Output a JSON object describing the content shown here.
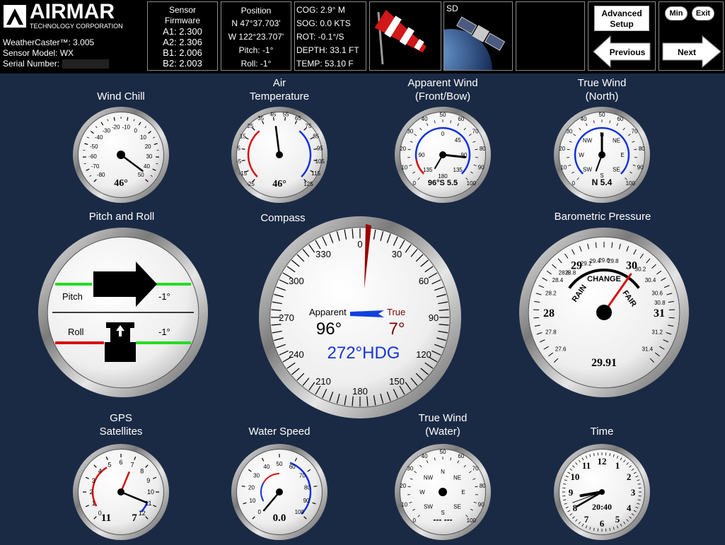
{
  "header": {
    "logo": {
      "name": "AIRMAR",
      "subtitle": "TECHNOLOGY CORPORATION"
    },
    "weathercaster_version": "WeatherCaster™: 3.005",
    "sensor_model": "Sensor Model: WX",
    "serial_label": "Serial Number:",
    "firmware": {
      "title1": "Sensor",
      "title2": "Firmware",
      "a1": "A1: 2.300",
      "a2": "A2: 2.306",
      "b1": "B1: 2.006",
      "b2": "B2: 2.003"
    },
    "position": {
      "title": "Position",
      "lat": "N 47°37.703'",
      "lon": "W 122°23.707'",
      "pitch": "Pitch: -1°",
      "roll": "Roll: -1°"
    },
    "nav_readout": {
      "cog": "COG: 2.9° M",
      "sog": "SOG: 0.0 KTS",
      "rot": "ROT: -0.1°/S",
      "depth": "DEPTH: 33.1 FT",
      "temp": "TEMP: 53.10 F"
    },
    "windsock_icon": "windsock-icon",
    "sd_label": "SD",
    "satellite_icon": "satellite-icon",
    "buttons": {
      "advanced_line1": "Advanced",
      "advanced_line2": "Setup",
      "min": "Min",
      "exit": "Exit",
      "previous": "Previous",
      "next": "Next"
    }
  },
  "gauges": {
    "wind_chill": {
      "label": "Wind Chill",
      "value": "46°",
      "ticks": [
        "-80",
        "-70",
        "-60",
        "-50",
        "-40",
        "-30",
        "-20",
        "-10",
        "0",
        "10",
        "20",
        "30",
        "40",
        "50"
      ],
      "needle_value": 46
    },
    "air_temp": {
      "label1": "Air",
      "label2": "Temperature",
      "value": "46°",
      "ticks": [
        "-25",
        "-15",
        "-5",
        "5",
        "15",
        "25",
        "35",
        "45",
        "55",
        "65",
        "75",
        "85",
        "95",
        "105",
        "115",
        "125"
      ],
      "needle_value": 46
    },
    "apparent_wind": {
      "label1": "Apparent Wind",
      "label2": "(Front/Bow)",
      "value": "96°S  5.5",
      "angle_ticks": [
        "0",
        "45",
        "90",
        "135",
        "180",
        "135",
        "90"
      ],
      "speed_ticks": [
        "0",
        "10",
        "20",
        "30",
        "40",
        "50",
        "60",
        "70",
        "80",
        "90",
        "100"
      ]
    },
    "true_wind_north": {
      "label1": "True Wind",
      "label2": "(North)",
      "value": "N 5.4",
      "dirs": [
        "N",
        "NE",
        "E",
        "SE",
        "S",
        "SW",
        "W",
        "NW"
      ],
      "speed_ticks": [
        "0",
        "10",
        "20",
        "30",
        "40",
        "50",
        "60",
        "70",
        "80",
        "90",
        "100"
      ]
    },
    "pitch_roll": {
      "label": "Pitch and Roll",
      "pitch_label": "Pitch",
      "pitch_value": "-1°",
      "roll_label": "Roll",
      "roll_value": "-1°"
    },
    "compass": {
      "label": "Compass",
      "ticks": [
        "0",
        "30",
        "60",
        "90",
        "120",
        "150",
        "180",
        "210",
        "240",
        "270",
        "300",
        "330"
      ],
      "apparent_label": "Apparent",
      "apparent_value": "96°",
      "true_label": "True",
      "true_value": "7°",
      "heading": "272°HDG"
    },
    "barometer": {
      "label": "Barometric Pressure",
      "major": [
        "28",
        "29",
        "30",
        "31"
      ],
      "minor": [
        "27.6",
        "27.8",
        "28.2",
        "28.4",
        "28.6",
        "28.8",
        "29.2",
        "29.4",
        "29.6",
        "29.8",
        "30.2",
        "30.4",
        "30.6",
        "30.8",
        "31.2",
        "31.4"
      ],
      "rain": "RAIN",
      "change": "CHANGE",
      "fair": "FAIR",
      "value": "29.91"
    },
    "gps": {
      "label1": "GPS",
      "label2": "Satellites",
      "ticks": [
        "0",
        "1",
        "2",
        "3",
        "4",
        "5",
        "6",
        "7",
        "8",
        "9",
        "10",
        "11",
        "12"
      ],
      "value_left": "11",
      "value_right": "7"
    },
    "water_speed": {
      "label": "Water Speed",
      "ticks": [
        "0",
        "10",
        "20",
        "30",
        "40",
        "50",
        "60",
        "70",
        "80",
        "90",
        "100"
      ],
      "value": "0.0"
    },
    "true_wind_water": {
      "label1": "True Wind",
      "label2": "(Water)",
      "dirs": [
        "N",
        "NE",
        "E",
        "SE",
        "S",
        "SW",
        "W",
        "NW"
      ],
      "speed_ticks": [
        "0",
        "10",
        "20",
        "30",
        "40",
        "50",
        "60",
        "70",
        "80",
        "90",
        "100"
      ],
      "value": "--- ---"
    },
    "time": {
      "label": "Time",
      "numbers": [
        "12",
        "1",
        "2",
        "3",
        "4",
        "5",
        "6",
        "7",
        "8",
        "9",
        "10",
        "11"
      ],
      "value": "20:40"
    }
  },
  "colors": {
    "background": "#1a2a44",
    "red": "#d81010",
    "blue": "#1030e0",
    "green": "#22dd22"
  }
}
